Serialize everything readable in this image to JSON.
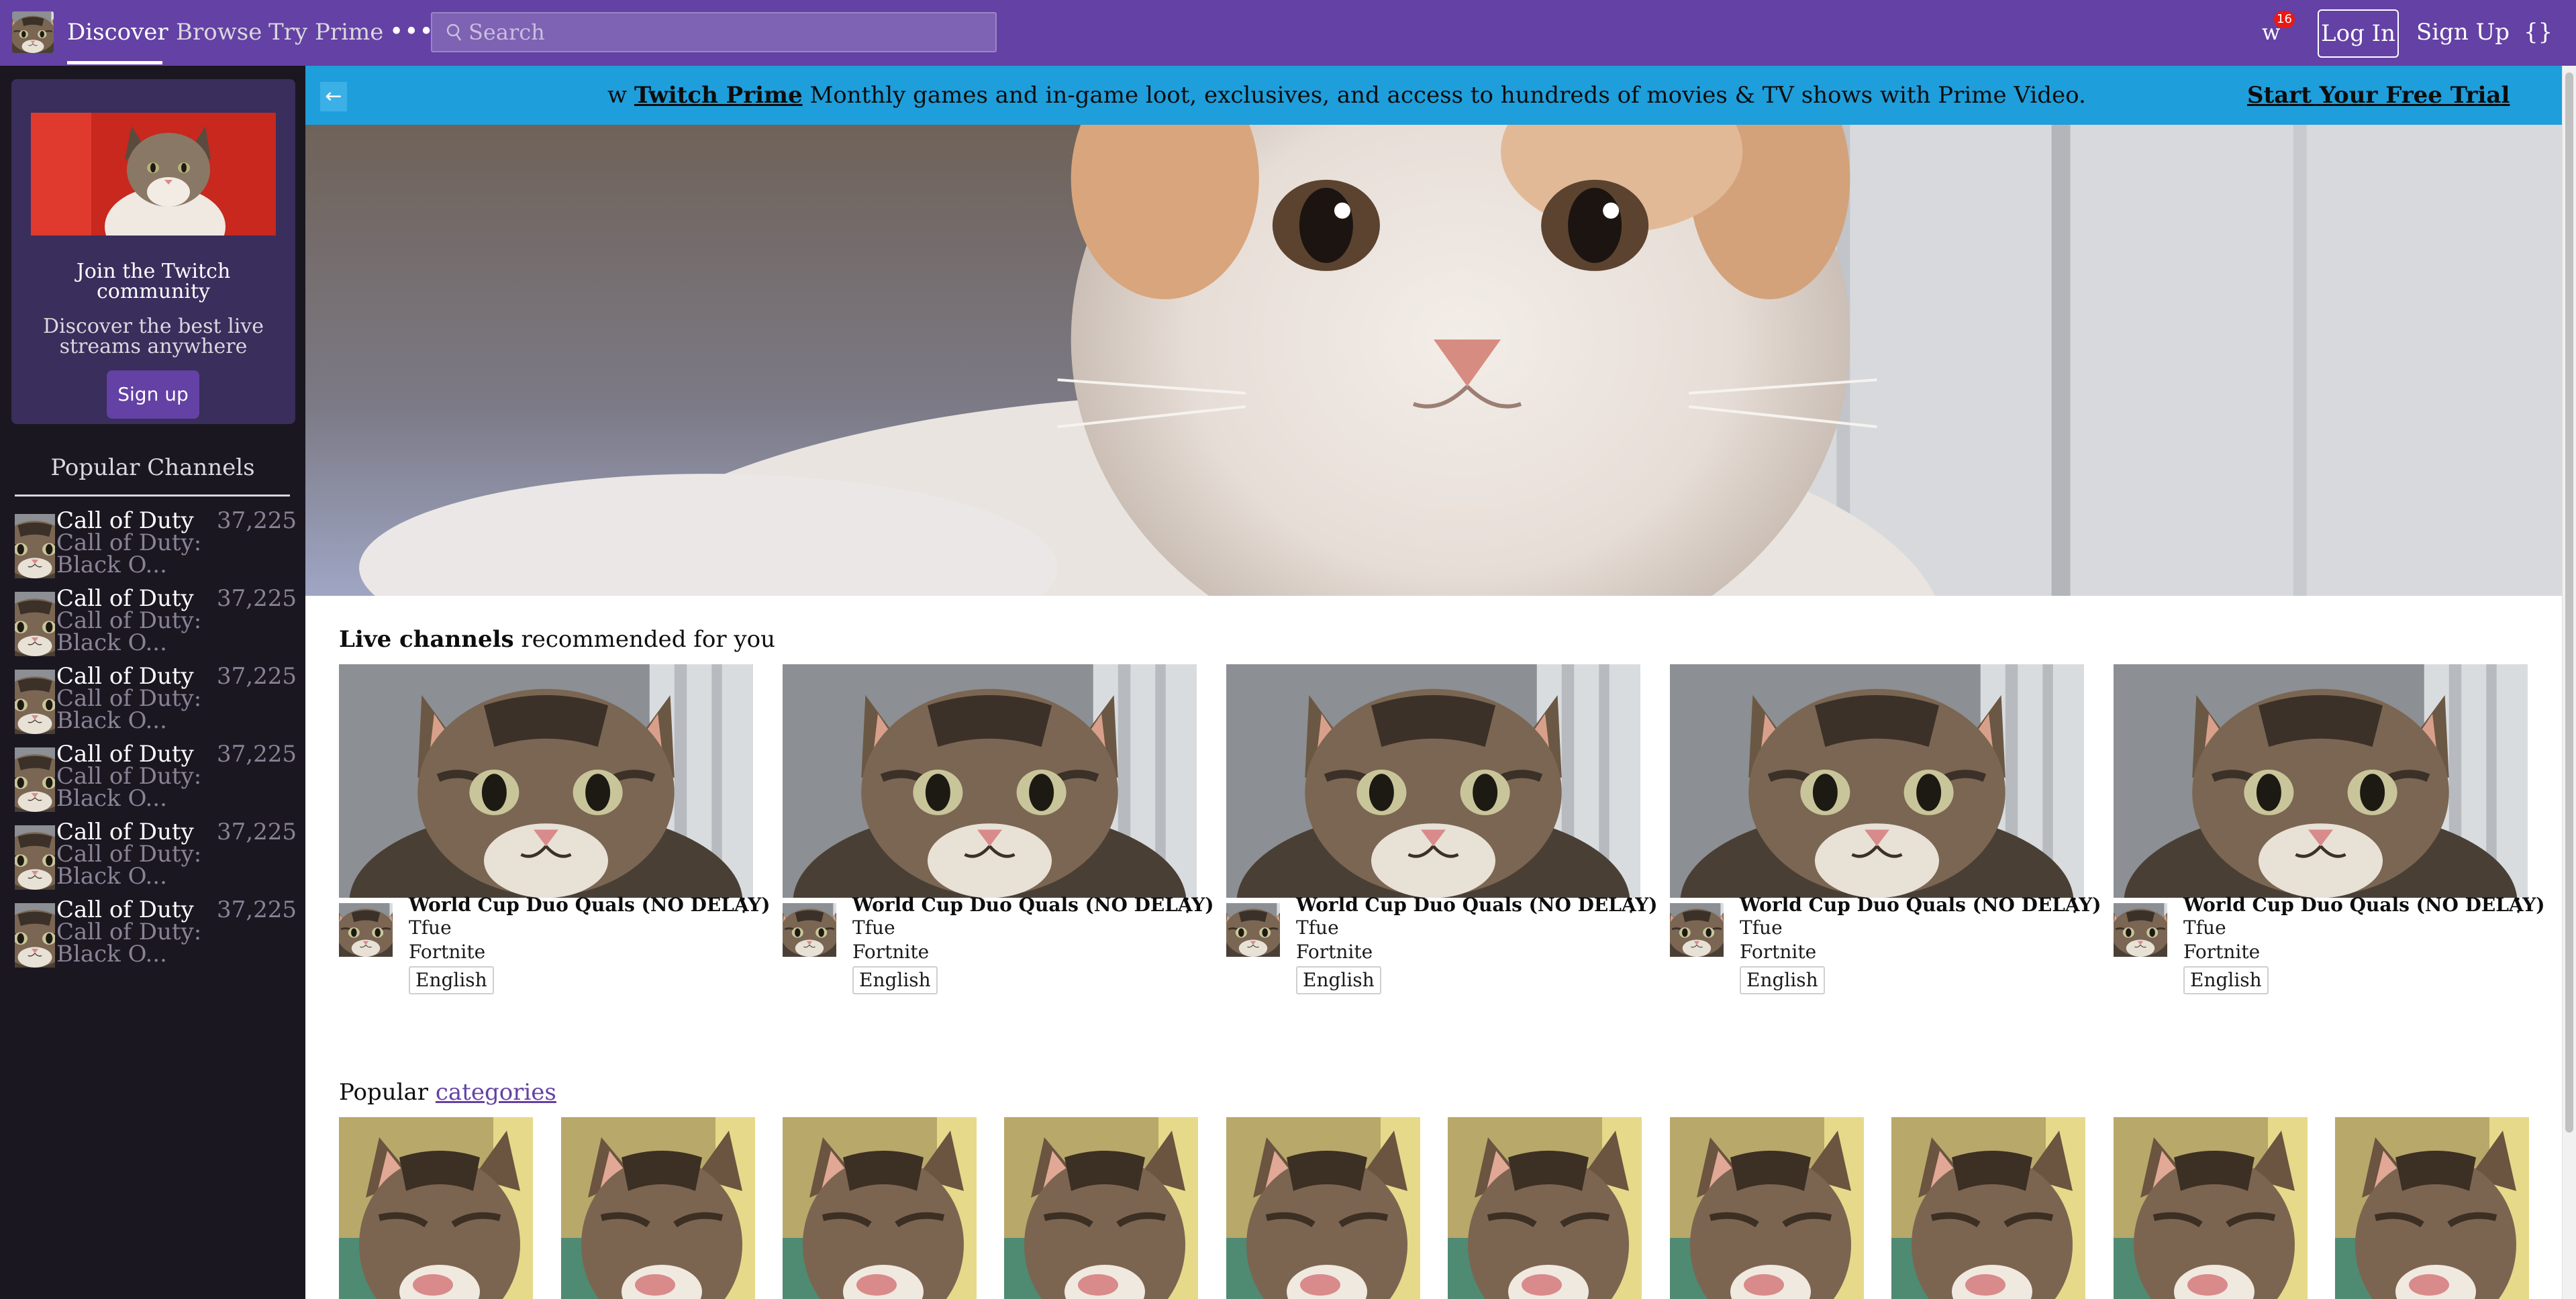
{
  "topbar": {
    "nav": {
      "discover": "Discover",
      "browse": "Browse",
      "try_prime": "Try Prime",
      "more": "•••"
    },
    "search": {
      "placeholder": "Search",
      "icon": "search-icon"
    },
    "whisper": {
      "label": "w",
      "badge": "16"
    },
    "login": "Log In",
    "signup": "Sign Up",
    "devtools": "{}"
  },
  "sidebar": {
    "join": {
      "title": "Join the Twitch community",
      "description": "Discover the best live streams anywhere",
      "button": "Sign up"
    },
    "popular_title": "Popular Channels",
    "channels": [
      {
        "name": "Call of Duty",
        "game": "Call of Duty: Black O...",
        "viewers": "37,225"
      },
      {
        "name": "Call of Duty",
        "game": "Call of Duty: Black O...",
        "viewers": "37,225"
      },
      {
        "name": "Call of Duty",
        "game": "Call of Duty: Black O...",
        "viewers": "37,225"
      },
      {
        "name": "Call of Duty",
        "game": "Call of Duty: Black O...",
        "viewers": "37,225"
      },
      {
        "name": "Call of Duty",
        "game": "Call of Duty: Black O...",
        "viewers": "37,225"
      },
      {
        "name": "Call of Duty",
        "game": "Call of Duty: Black O...",
        "viewers": "37,225"
      }
    ]
  },
  "prime_banner": {
    "collapse_icon": "arrow-left-icon",
    "prefix": "w",
    "brand": "Twitch Prime",
    "message": "Monthly games and in-game loot, exclusives, and access to hundreds of movies & TV shows with Prime Video.",
    "cta": "Start Your Free Trial"
  },
  "live": {
    "title_bold": "Live channels",
    "title_rest": "recommended for you",
    "cards": [
      {
        "title": "World Cup Duo Quals (NO DELAY)",
        "user": "Tfue",
        "game": "Fortnite",
        "tag": "English"
      },
      {
        "title": "World Cup Duo Quals (NO DELAY)",
        "user": "Tfue",
        "game": "Fortnite",
        "tag": "English"
      },
      {
        "title": "World Cup Duo Quals (NO DELAY)",
        "user": "Tfue",
        "game": "Fortnite",
        "tag": "English"
      },
      {
        "title": "World Cup Duo Quals (NO DELAY)",
        "user": "Tfue",
        "game": "Fortnite",
        "tag": "English"
      },
      {
        "title": "World Cup Duo Quals (NO DELAY)",
        "user": "Tfue",
        "game": "Fortnite",
        "tag": "English"
      }
    ],
    "menu_icon": "⋮"
  },
  "categories": {
    "title_plain": "Popular",
    "title_link": "categories",
    "count": 10
  },
  "colors": {
    "brand": "#6441a4",
    "prime_banner": "#1e9edb",
    "sidebar": "#1b1721",
    "badge": "#e91916"
  }
}
